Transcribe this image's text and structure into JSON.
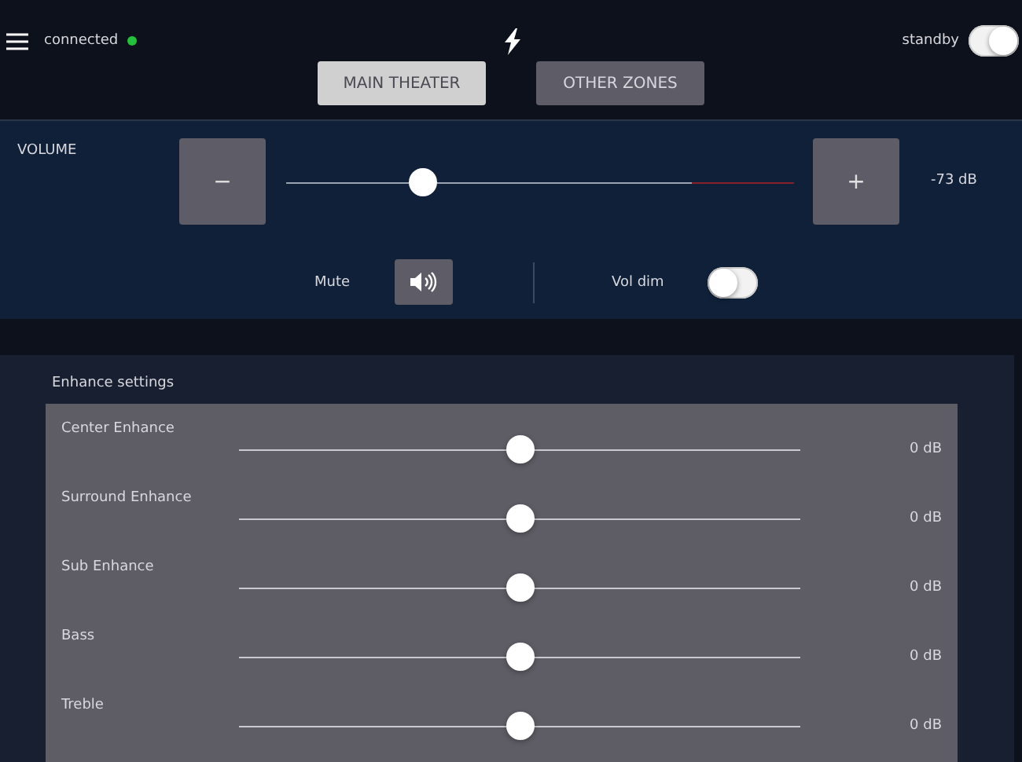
{
  "header": {
    "status": "connected",
    "connected": true,
    "standby": {
      "label": "standby",
      "on": true
    }
  },
  "tabs": [
    {
      "label": "MAIN THEATER",
      "selected": true
    },
    {
      "label": "OTHER ZONES",
      "selected": false
    }
  ],
  "volume": {
    "label": "VOLUME",
    "minus": "−",
    "plus": "+",
    "level": 0.27,
    "reading": "-73 dB",
    "mute": {
      "label": "Mute",
      "muted": false
    },
    "vol_dim": {
      "label": "Vol dim",
      "on": false
    }
  },
  "enhance": {
    "title": "Enhance settings",
    "sliders": [
      {
        "name": "Center Enhance",
        "level": 0.5,
        "reading": "0 dB"
      },
      {
        "name": "Surround Enhance",
        "level": 0.5,
        "reading": "0 dB"
      },
      {
        "name": "Sub Enhance",
        "level": 0.5,
        "reading": "0 dB"
      },
      {
        "name": "Bass",
        "level": 0.5,
        "reading": "0 dB"
      },
      {
        "name": "Treble",
        "level": 0.5,
        "reading": "0 dB"
      }
    ]
  }
}
